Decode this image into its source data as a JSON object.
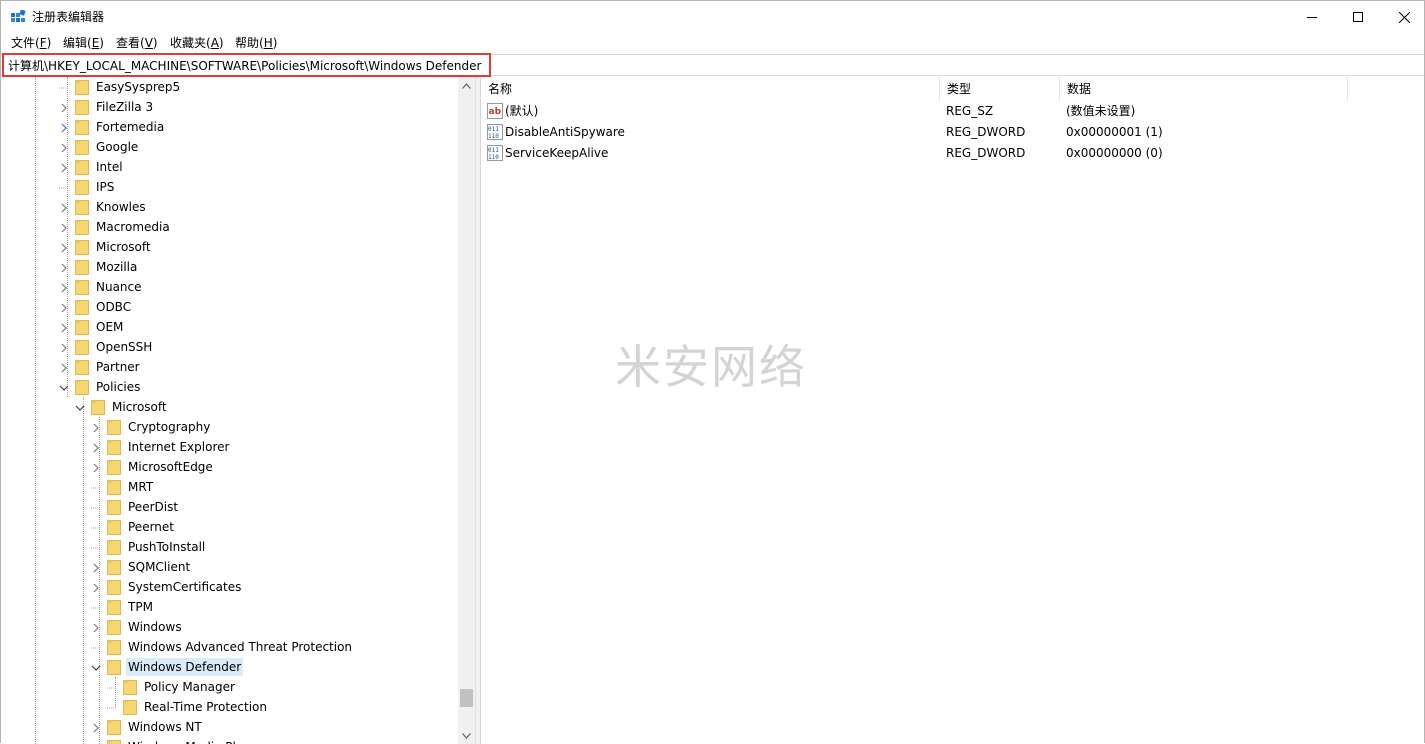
{
  "window": {
    "title": "注册表编辑器",
    "controls": {
      "minimize": "—",
      "maximize": "☐",
      "close": "✕"
    }
  },
  "menu": [
    {
      "label": "文件(",
      "key": "F",
      "end": ")"
    },
    {
      "label": "编辑(",
      "key": "E",
      "end": ")"
    },
    {
      "label": "查看(",
      "key": "V",
      "end": ")"
    },
    {
      "label": "收藏夹(",
      "key": "A",
      "end": ")"
    },
    {
      "label": "帮助(",
      "key": "H",
      "end": ")"
    }
  ],
  "address": "计算机\\HKEY_LOCAL_MACHINE\\SOFTWARE\\Policies\\Microsoft\\Windows Defender",
  "tree": {
    "items": [
      {
        "label": "EasySysprep5",
        "expander": "none"
      },
      {
        "label": "FileZilla 3",
        "expander": "collapsed"
      },
      {
        "label": "Fortemedia",
        "expander": "collapsed-blue"
      },
      {
        "label": "Google",
        "expander": "collapsed"
      },
      {
        "label": "Intel",
        "expander": "collapsed"
      },
      {
        "label": "IPS",
        "expander": "none"
      },
      {
        "label": "Knowles",
        "expander": "collapsed"
      },
      {
        "label": "Macromedia",
        "expander": "collapsed"
      },
      {
        "label": "Microsoft",
        "expander": "collapsed"
      },
      {
        "label": "Mozilla",
        "expander": "collapsed"
      },
      {
        "label": "Nuance",
        "expander": "collapsed"
      },
      {
        "label": "ODBC",
        "expander": "collapsed"
      },
      {
        "label": "OEM",
        "expander": "collapsed"
      },
      {
        "label": "OpenSSH",
        "expander": "collapsed"
      },
      {
        "label": "Partner",
        "expander": "collapsed"
      },
      {
        "label": "Policies",
        "expander": "expanded"
      },
      {
        "label": "Microsoft",
        "expander": "expanded"
      },
      {
        "label": "Cryptography",
        "expander": "collapsed"
      },
      {
        "label": "Internet Explorer",
        "expander": "collapsed"
      },
      {
        "label": "MicrosoftEdge",
        "expander": "collapsed"
      },
      {
        "label": "MRT",
        "expander": "none"
      },
      {
        "label": "PeerDist",
        "expander": "none"
      },
      {
        "label": "Peernet",
        "expander": "none"
      },
      {
        "label": "PushToInstall",
        "expander": "none"
      },
      {
        "label": "SQMClient",
        "expander": "collapsed"
      },
      {
        "label": "SystemCertificates",
        "expander": "collapsed"
      },
      {
        "label": "TPM",
        "expander": "none"
      },
      {
        "label": "Windows",
        "expander": "collapsed"
      },
      {
        "label": "Windows Advanced Threat Protection",
        "expander": "none"
      },
      {
        "label": "Windows Defender",
        "expander": "expanded",
        "selected": true
      },
      {
        "label": "Policy Manager",
        "expander": "none"
      },
      {
        "label": "Real-Time Protection",
        "expander": "none"
      },
      {
        "label": "Windows NT",
        "expander": "collapsed"
      },
      {
        "label": "Windows Media Player",
        "expander": "collapsed"
      }
    ]
  },
  "values": {
    "headers": {
      "name": "名称",
      "type": "类型",
      "data": "数据"
    },
    "rows": [
      {
        "icon": "string-value-icon",
        "name": "(默认)",
        "type": "REG_SZ",
        "data": "(数值未设置)"
      },
      {
        "icon": "dword-value-icon",
        "name": "DisableAntiSpyware",
        "type": "REG_DWORD",
        "data": "0x00000001 (1)"
      },
      {
        "icon": "dword-value-icon",
        "name": "ServiceKeepAlive",
        "type": "REG_DWORD",
        "data": "0x00000000 (0)"
      }
    ]
  },
  "watermark": "米安网络",
  "colors": {
    "selection": "#d9ebf9",
    "folder": "#f7d774",
    "highlight_box": "#e53935"
  }
}
